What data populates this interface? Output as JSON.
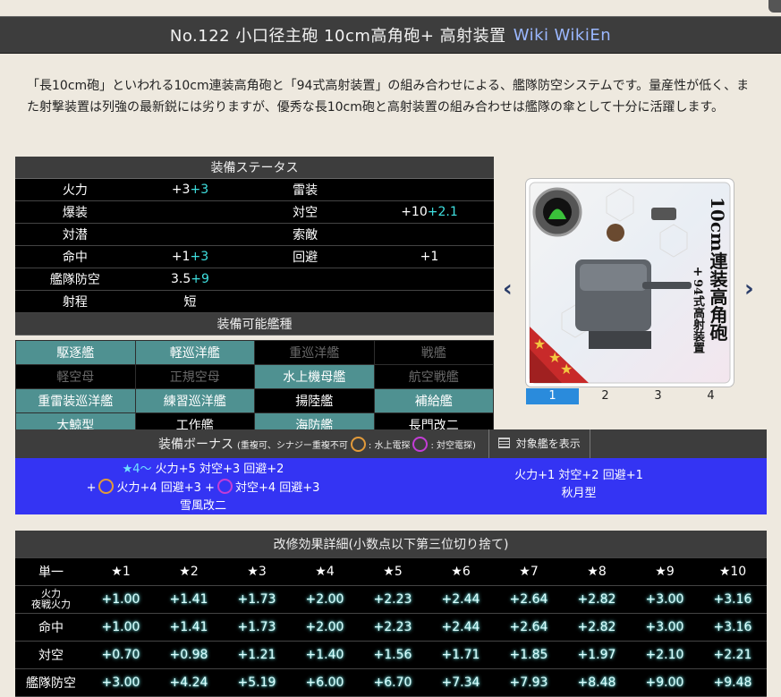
{
  "header": {
    "title": "No.122 小口径主砲 10cm高角砲+ 高射装置",
    "link_wiki": "Wiki",
    "link_wikien": "WikiEn"
  },
  "description": "「長10cm砲」といわれる10cm連装高角砲と「94式高射装置」の組み合わせによる、艦隊防空システムです。量産性が低く、また射撃装置は列強の最新鋭には劣りますが、優秀な長10cm砲と高射装置の組み合わせは艦隊の傘として十分に活躍します。",
  "status": {
    "title": "装備ステータス",
    "rows": [
      {
        "l1": "火力",
        "v1": "+3",
        "b1": "+3",
        "l2": "雷装",
        "v2": "",
        "b2": ""
      },
      {
        "l1": "爆装",
        "v1": "",
        "b1": "",
        "l2": "対空",
        "v2": "+10",
        "b2": "+2.1"
      },
      {
        "l1": "対潜",
        "v1": "",
        "b1": "",
        "l2": "索敵",
        "v2": "",
        "b2": ""
      },
      {
        "l1": "命中",
        "v1": "+1",
        "b1": "+3",
        "l2": "回避",
        "v2": "+1",
        "b2": ""
      },
      {
        "l1": "艦隊防空",
        "v1": "3.5",
        "b1": "+9",
        "l2": "",
        "v2": "",
        "b2": ""
      },
      {
        "l1": "射程",
        "v1": "短",
        "b1": "",
        "l2": "",
        "v2": "",
        "b2": ""
      }
    ]
  },
  "ships": {
    "title": "装備可能艦種",
    "rows": [
      [
        "駆逐艦",
        "軽巡洋艦",
        "重巡洋艦",
        "戦艦"
      ],
      [
        "軽空母",
        "正規空母",
        "水上機母艦",
        "航空戦艦"
      ],
      [
        "重雷装巡洋艦",
        "練習巡洋艦",
        "揚陸艦",
        "補給艦"
      ],
      [
        "大鯨型",
        "工作艦",
        "海防艦",
        "長門改二"
      ]
    ]
  },
  "card": {
    "name_main": "10cm連装高角砲",
    "name_plus": "+",
    "name_sub": "94式高射装置",
    "pages": [
      "1",
      "2",
      "3",
      "4"
    ],
    "active_page": "1"
  },
  "bonus": {
    "title": "装備ボーナス",
    "subtitle": "(重複可、シナジー重複不可",
    "water_label": ": 水上電探",
    "air_label": ": 対空電探)",
    "show_label": "対象艦を表示",
    "left_line1_star": "★4～",
    "left_line1": "火力+5 対空+3 回避+2",
    "left_line2a": "火力+4 回避+3 +",
    "left_line2b": "対空+4 回避+3",
    "left_ship": "雪風改二",
    "right_line": "火力+1 対空+2 回避+1",
    "right_ship": "秋月型"
  },
  "modify": {
    "title": "改修効果詳細(小数点以下第三位切り捨て)",
    "col_label": "単一",
    "stars": [
      "★1",
      "★2",
      "★3",
      "★4",
      "★5",
      "★6",
      "★7",
      "★8",
      "★9",
      "★10"
    ],
    "rows": [
      {
        "label": "火力\n夜戦火力",
        "values": [
          "+1.00",
          "+1.41",
          "+1.73",
          "+2.00",
          "+2.23",
          "+2.44",
          "+2.64",
          "+2.82",
          "+3.00",
          "+3.16"
        ]
      },
      {
        "label": "命中",
        "values": [
          "+1.00",
          "+1.41",
          "+1.73",
          "+2.00",
          "+2.23",
          "+2.44",
          "+2.64",
          "+2.82",
          "+3.00",
          "+3.16"
        ]
      },
      {
        "label": "対空",
        "values": [
          "+0.70",
          "+0.98",
          "+1.21",
          "+1.40",
          "+1.56",
          "+1.71",
          "+1.85",
          "+1.97",
          "+2.10",
          "+2.21"
        ]
      },
      {
        "label": "艦隊防空",
        "values": [
          "+3.00",
          "+4.24",
          "+5.19",
          "+6.00",
          "+6.70",
          "+7.34",
          "+7.93",
          "+8.48",
          "+9.00",
          "+9.48"
        ]
      }
    ]
  }
}
